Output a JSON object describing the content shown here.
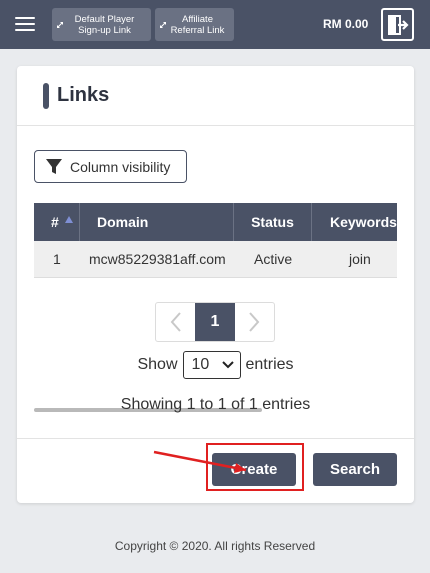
{
  "topbar": {
    "menu_icon": "hamburger-menu-icon",
    "links": [
      {
        "label_line1": "Default Player",
        "label_line2": "Sign-up Link",
        "icon": "link-icon"
      },
      {
        "label_line1": "Affiliate",
        "label_line2": "Referral Link",
        "icon": "link-icon"
      }
    ],
    "balance": "RM 0.00",
    "logout_icon": "logout-icon"
  },
  "card": {
    "title": "Links",
    "column_visibility_label": "Column visibility",
    "table": {
      "headers": [
        "#",
        "Domain",
        "Status",
        "Keywords"
      ],
      "rows": [
        {
          "num": "1",
          "domain": "mcw85229381aff.com",
          "status": "Active",
          "keywords": "join"
        }
      ]
    },
    "pagination": {
      "current_page": "1"
    },
    "show_label": "Show",
    "entries_select": "10",
    "entries_label": "entries",
    "info": "Showing 1 to 1 of 1 entries",
    "create_label": "Create",
    "search_label": "Search"
  },
  "footer": {
    "copyright": "Copyright © 2020. All rights Reserved"
  },
  "colors": {
    "header_bg": "#4a5266",
    "annotation_red": "#e02020"
  }
}
